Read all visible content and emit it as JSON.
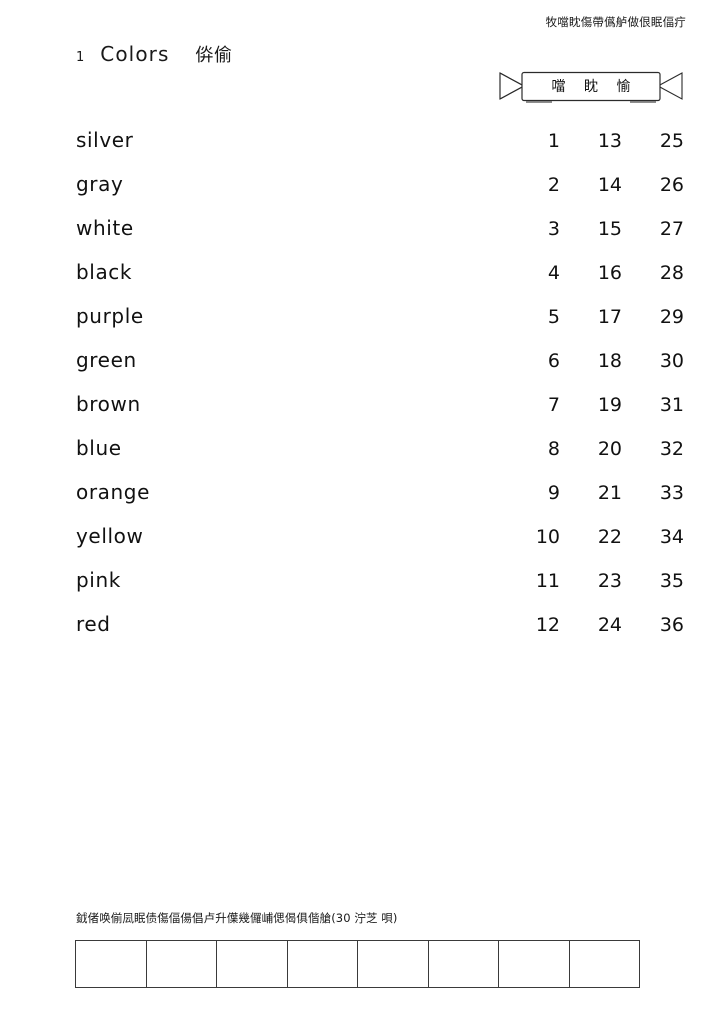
{
  "header": {
    "text": "牧噹眈傷帶儰舻做佷眠偪疔"
  },
  "title": {
    "number": "1",
    "main": "Colors",
    "cjk": "㑞偷"
  },
  "banner": {
    "label": "噹 眈 愉"
  },
  "list": {
    "rows": [
      {
        "word": "silver",
        "n1": "1",
        "n2": "13",
        "n3": "25"
      },
      {
        "word": "gray",
        "n1": "2",
        "n2": "14",
        "n3": "26"
      },
      {
        "word": "white",
        "n1": "3",
        "n2": "15",
        "n3": "27"
      },
      {
        "word": "black",
        "n1": "4",
        "n2": "16",
        "n3": "28"
      },
      {
        "word": "purple",
        "n1": "5",
        "n2": "17",
        "n3": "29"
      },
      {
        "word": "green",
        "n1": "6",
        "n2": "18",
        "n3": "30"
      },
      {
        "word": "brown",
        "n1": "7",
        "n2": "19",
        "n3": "31"
      },
      {
        "word": "blue",
        "n1": "8",
        "n2": "20",
        "n3": "32"
      },
      {
        "word": "orange",
        "n1": "9",
        "n2": "21",
        "n3": "33"
      },
      {
        "word": "yellow",
        "n1": "10",
        "n2": "22",
        "n3": "34"
      },
      {
        "word": "pink",
        "n1": "11",
        "n2": "23",
        "n3": "35"
      },
      {
        "word": "red",
        "n1": "12",
        "n2": "24",
        "n3": "36"
      }
    ]
  },
  "footer": {
    "note": "龯偖唤偂凨眠债傷偪偒倡卢升僷幾儸峬偲偈俱偕艙(30 泞芝 唄)"
  },
  "answer_grid": {
    "cells": [
      "",
      "",
      "",
      "",
      "",
      "",
      "",
      ""
    ]
  }
}
